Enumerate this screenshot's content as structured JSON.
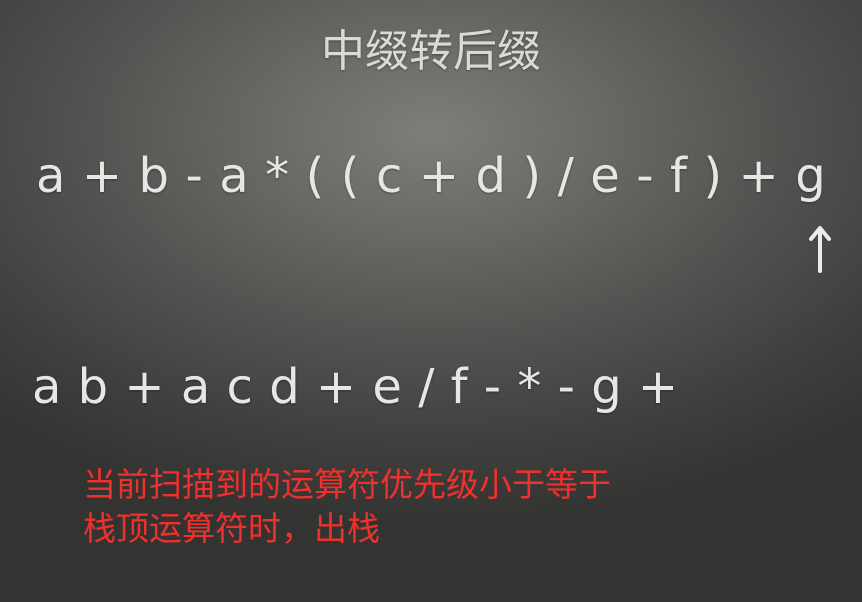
{
  "slide": {
    "title": "中缀转后缀",
    "infix_expression": "a + b - a * ( ( c + d ) / e - f ) + g",
    "postfix_expression": "a b + a c d + e / f - * - g +",
    "scan_pointer": "up-arrow-icon",
    "note_line_1": "当前扫描到的运算符优先级小于等于",
    "note_line_2": "栈顶运算符时，出栈"
  },
  "colors": {
    "background": "#5a5b58",
    "text": "#e6e6e4",
    "note": "#f0302c"
  }
}
